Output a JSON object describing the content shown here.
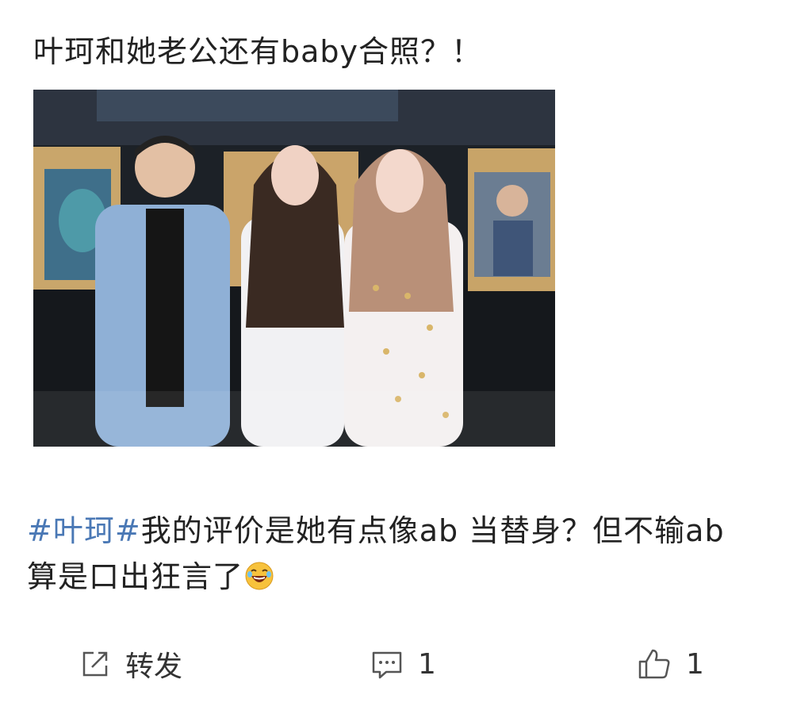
{
  "post": {
    "title": "叶珂和她老公还有baby合照？！",
    "body": {
      "hashtag": "#叶珂#",
      "text_line1": "我的评价是她有点像ab 当替身？但不输ab",
      "text_line2": "算是口出狂言了",
      "emoji": "laughing-face-emoji"
    }
  },
  "actions": {
    "repost_label": "转发",
    "comment_count": "1",
    "like_count": "1"
  },
  "icons": {
    "repost": "share-icon",
    "comment": "comment-icon",
    "like": "thumbs-up-icon"
  },
  "colors": {
    "hashtag": "#4a78b5",
    "text": "#222222",
    "icon": "#555555"
  }
}
